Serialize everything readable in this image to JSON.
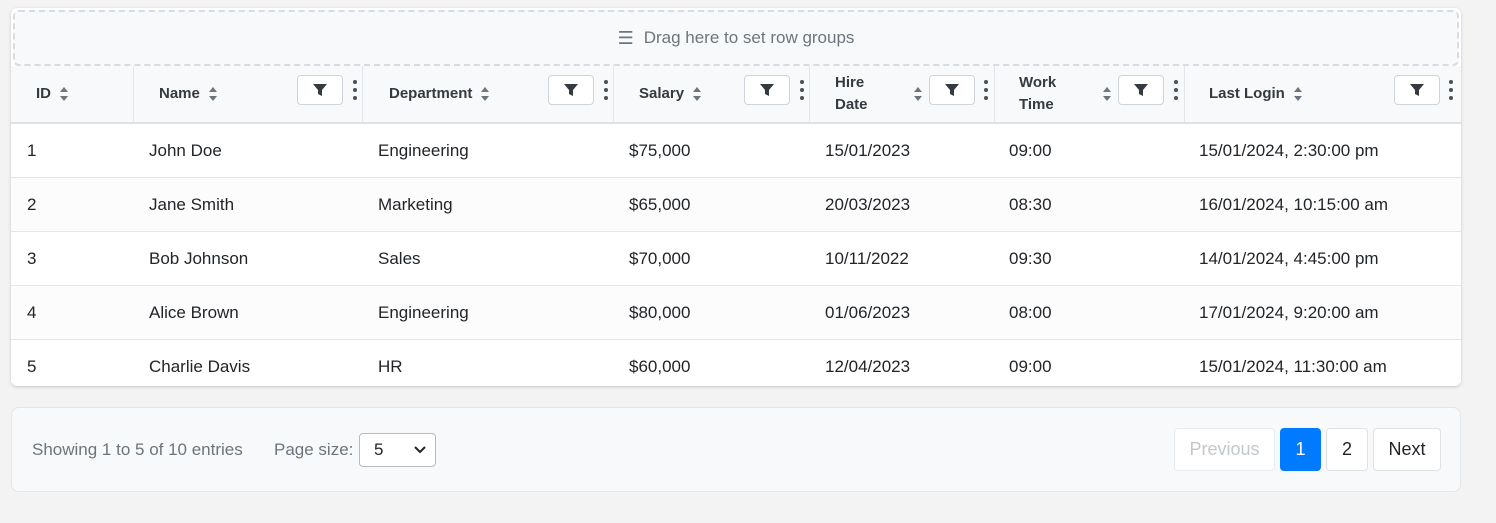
{
  "group_zone": {
    "text": "Drag here to set row groups"
  },
  "columns": [
    {
      "key": "id",
      "label": "ID"
    },
    {
      "key": "name",
      "label": "Name"
    },
    {
      "key": "department",
      "label": "Department"
    },
    {
      "key": "salary",
      "label": "Salary"
    },
    {
      "key": "hire_date",
      "label": "Hire Date",
      "line1": "Hire",
      "line2": "Date"
    },
    {
      "key": "work_time",
      "label": "Work Time",
      "line1": "Work",
      "line2": "Time"
    },
    {
      "key": "last_login",
      "label": "Last Login"
    }
  ],
  "rows": [
    {
      "id": "1",
      "name": "John Doe",
      "department": "Engineering",
      "salary": "$75,000",
      "hire_date": "15/01/2023",
      "work_time": "09:00",
      "last_login": "15/01/2024, 2:30:00 pm"
    },
    {
      "id": "2",
      "name": "Jane Smith",
      "department": "Marketing",
      "salary": "$65,000",
      "hire_date": "20/03/2023",
      "work_time": "08:30",
      "last_login": "16/01/2024, 10:15:00 am"
    },
    {
      "id": "3",
      "name": "Bob Johnson",
      "department": "Sales",
      "salary": "$70,000",
      "hire_date": "10/11/2022",
      "work_time": "09:30",
      "last_login": "14/01/2024, 4:45:00 pm"
    },
    {
      "id": "4",
      "name": "Alice Brown",
      "department": "Engineering",
      "salary": "$80,000",
      "hire_date": "01/06/2023",
      "work_time": "08:00",
      "last_login": "17/01/2024, 9:20:00 am"
    },
    {
      "id": "5",
      "name": "Charlie Davis",
      "department": "HR",
      "salary": "$60,000",
      "hire_date": "12/04/2023",
      "work_time": "09:00",
      "last_login": "15/01/2024, 11:30:00 am"
    }
  ],
  "footer": {
    "showing_text": "Showing 1 to 5 of 10 entries",
    "page_size_label": "Page size:",
    "page_size_value": "5",
    "prev_label": "Previous",
    "pages": [
      "1",
      "2"
    ],
    "current_page": "1",
    "next_label": "Next"
  },
  "colors": {
    "accent": "#007bff",
    "header_bg": "#f8f9fa",
    "page_bg": "#f3f3f3",
    "muted_text": "#6c757d"
  },
  "icons": {
    "group_zone": "menu-lines-icon",
    "sort": "sort-icon",
    "filter": "filter-icon",
    "column_menu": "kebab-menu-icon",
    "select": "chevron-down-icon"
  }
}
